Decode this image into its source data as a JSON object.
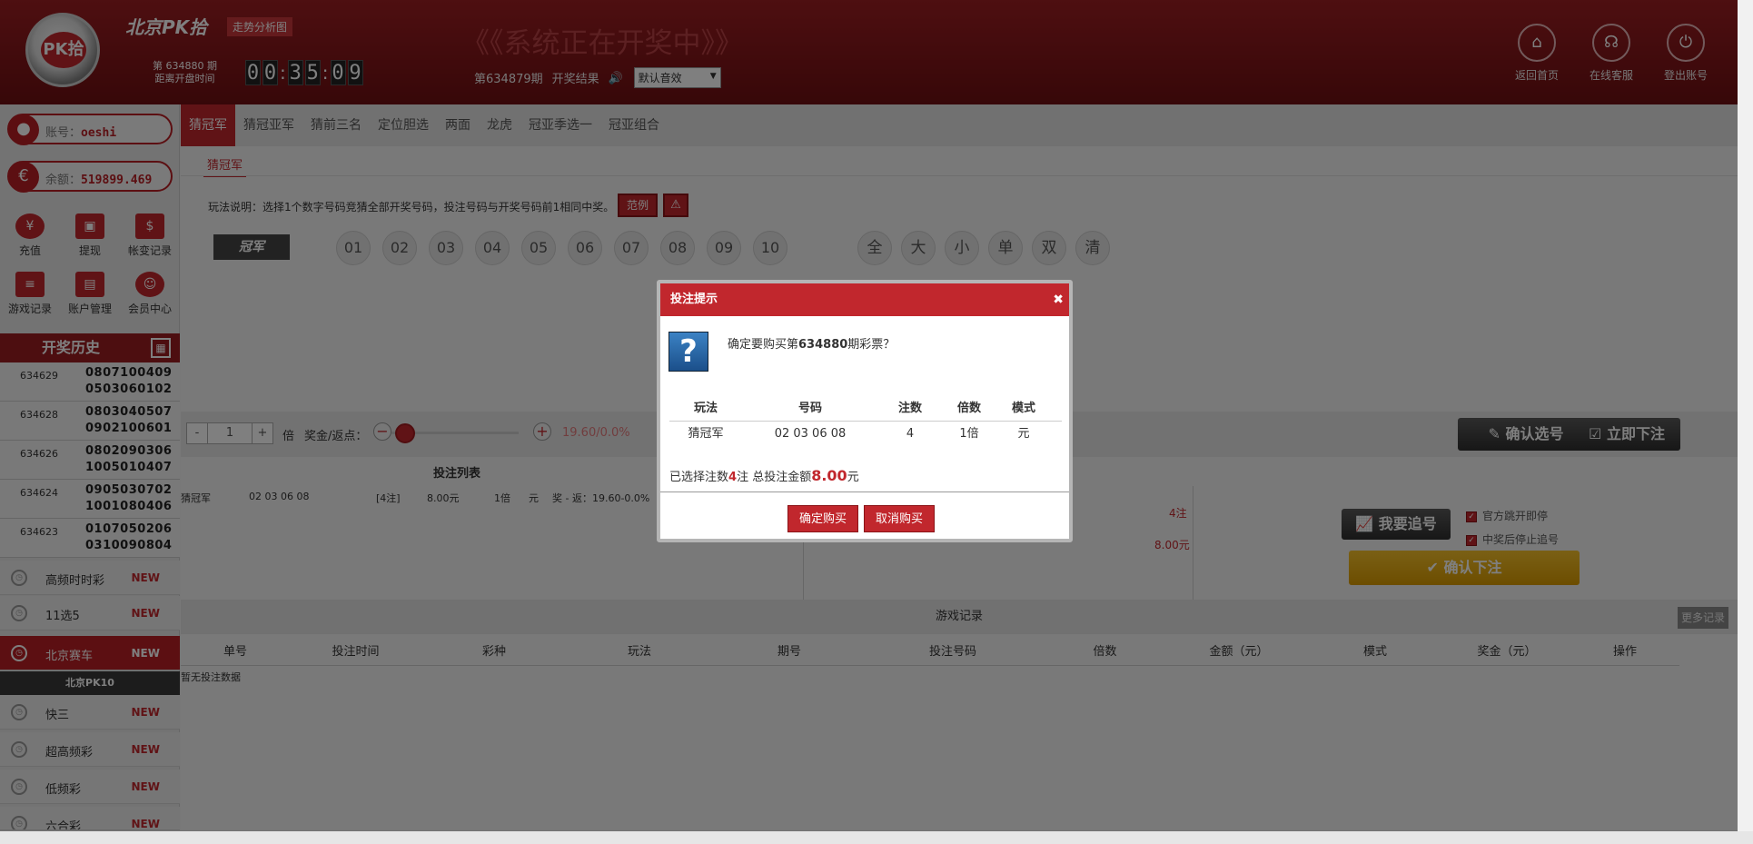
{
  "header": {
    "site_name": "北京PK拾",
    "site_sub": "走势分析图",
    "logo_text": "PK拾",
    "issue_next_line1": "第 634880 期",
    "issue_next_line2": "距离开盘时间",
    "timer": [
      "0",
      "0",
      ":",
      "3",
      "5",
      ":",
      "0",
      "9"
    ],
    "status_title": "《《系统正在开奖中》》",
    "draw_issue": "第634879期",
    "draw_result_label": "开奖结果",
    "sound_select": "默认音效",
    "links": [
      {
        "label": "返回首页",
        "icon": "home-icon"
      },
      {
        "label": "在线客服",
        "icon": "headset-icon"
      },
      {
        "label": "登出账号",
        "icon": "power-icon"
      }
    ]
  },
  "sidebar": {
    "account_label": "账号：",
    "account_value": "oeshi",
    "balance_label": "余额：",
    "balance_value": "519899.469",
    "quick_row1": [
      {
        "label": "充值",
        "icon": "yen-icon"
      },
      {
        "label": "提现",
        "icon": "wallet-icon"
      },
      {
        "label": "帐变记录",
        "icon": "ledger-icon"
      }
    ],
    "quick_row2": [
      {
        "label": "游戏记录",
        "icon": "record-icon"
      },
      {
        "label": "账户管理",
        "icon": "account-icon"
      },
      {
        "label": "会员中心",
        "icon": "member-icon"
      }
    ],
    "history_title": "开奖历史",
    "history": [
      {
        "issue": "634629",
        "line1": "0807100409",
        "line2": "0503060102"
      },
      {
        "issue": "634628",
        "line1": "0803040507",
        "line2": "0902100601"
      },
      {
        "issue": "634626",
        "line1": "0802090306",
        "line2": "1005010407"
      },
      {
        "issue": "634624",
        "line1": "0905030702",
        "line2": "1001080406"
      },
      {
        "issue": "634623",
        "line1": "0107050206",
        "line2": "0310090804"
      }
    ],
    "new_badge": "NEW",
    "menu": [
      "高频时时彩",
      "11选5",
      "北京赛车",
      "快三",
      "超高频彩",
      "低频彩",
      "六合彩"
    ],
    "submenu": "北京PK10"
  },
  "main": {
    "tabs": [
      "猜冠军",
      "猜冠亚军",
      "猜前三名",
      "定位胆选",
      "两面",
      "龙虎",
      "冠亚季选一",
      "冠亚组合"
    ],
    "subtab": "猜冠军",
    "rule": "玩法说明：选择1个数字号码竞猜全部开奖号码，投注号码与开奖号码前1相同中奖。",
    "example_btn": "范例",
    "position_label": "冠军",
    "balls": [
      "01",
      "02",
      "03",
      "04",
      "05",
      "06",
      "07",
      "08",
      "09",
      "10"
    ],
    "filters": [
      "全",
      "大",
      "小",
      "单",
      "双",
      "清"
    ],
    "multiplier": "1",
    "bei": "倍",
    "rebate_label": "奖金/返点：",
    "rebate_value": "19.60/0.0%",
    "confirm_select": "确认选号",
    "bet_now": "立即下注",
    "list_title": "投注列表",
    "list_row": {
      "play": "猜冠军",
      "nums": "02 03 06 08",
      "count": "[4注]",
      "amount": "8.00元",
      "mult": "1倍",
      "mode": "元",
      "prize": "奖 - 返：19.60-0.0%"
    },
    "right_count": "4注",
    "right_amount": "8.00元",
    "chase_btn": "我要追号",
    "check1": "官方跳开即停",
    "check2": "中奖后停止追号",
    "confirm_bet": "确认下注",
    "records_title": "游戏记录",
    "more_records": "更多记录",
    "record_headers": [
      "单号",
      "投注时间",
      "彩种",
      "玩法",
      "期号",
      "投注号码",
      "倍数",
      "金额（元）",
      "模式",
      "奖金（元）",
      "操作"
    ],
    "no_data": "暂无投注数据"
  },
  "modal": {
    "title": "投注提示",
    "close": "✖",
    "question_pre": "确定要购买第",
    "question_issue": "634880",
    "question_post": "期彩票？",
    "headers": [
      "玩法",
      "号码",
      "注数",
      "倍数",
      "模式"
    ],
    "row": [
      "猜冠军",
      "02 03 06 08",
      "4",
      "1倍",
      "元"
    ],
    "sum_pre": "已选择注数",
    "sum_count": "4",
    "sum_mid": "注 总投注金额",
    "sum_amount": "8.00",
    "sum_post": "元",
    "confirm": "确定购买",
    "cancel": "取消购买"
  }
}
